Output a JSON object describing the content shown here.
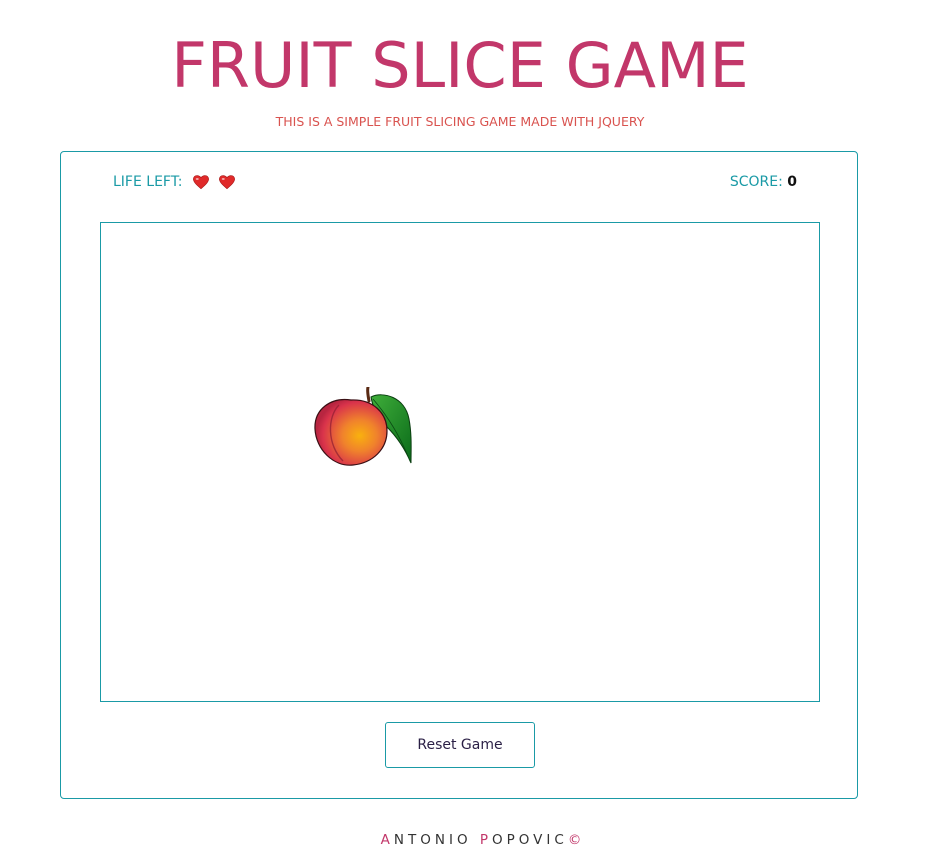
{
  "header": {
    "title": "FRUIT SLICE GAME",
    "subtitle": "THIS IS A SIMPLE FRUIT SLICING GAME MADE WITH JQUERY"
  },
  "status": {
    "life_label": "LIFE LEFT:",
    "lives": 2,
    "life_icon": "heart-icon",
    "score_label": "SCORE:",
    "score_value": "0"
  },
  "game": {
    "fruit": "peach"
  },
  "controls": {
    "reset_label": "Reset Game"
  },
  "footer": {
    "first_initial": "A",
    "first_rest": "NTONIO ",
    "last_initial": "P",
    "last_rest": "OPOVIC",
    "copyright": "©"
  },
  "colors": {
    "title": "#c2376a",
    "subtitle": "#d9534f",
    "accent": "#1a9aa6",
    "heart": "#e02a2a"
  }
}
